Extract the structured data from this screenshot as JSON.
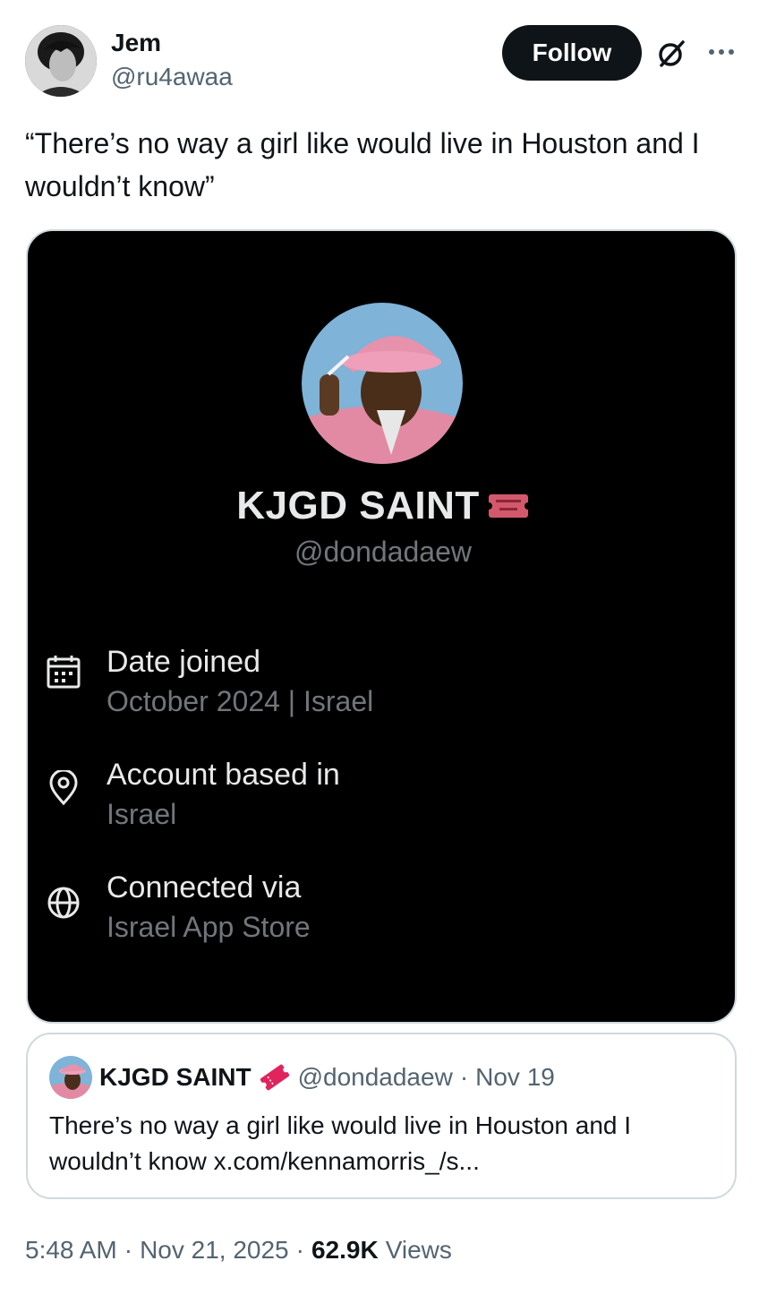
{
  "author": {
    "name": "Jem",
    "handle": "@ru4awaa",
    "follow_label": "Follow"
  },
  "tweet": {
    "text": "“There’s no way a girl like would live in Houston and I wouldn’t know”"
  },
  "media": {
    "profile_name": "KJGD SAINT",
    "profile_handle": "@dondadaew",
    "info": [
      {
        "icon": "calendar-icon",
        "title": "Date joined",
        "value": "October 2024 | Israel"
      },
      {
        "icon": "location-pin-icon",
        "title": "Account based in",
        "value": "Israel"
      },
      {
        "icon": "globe-icon",
        "title": "Connected via",
        "value": "Israel App Store"
      }
    ]
  },
  "quote": {
    "name": "KJGD SAINT",
    "handle": "@dondadaew",
    "separator": "·",
    "date": "Nov 19",
    "text": "There’s no way a girl like would live in Houston and I wouldn’t know x.com/kennamorris_/s..."
  },
  "meta": {
    "time": "5:48 AM",
    "separator": "·",
    "date": "Nov 21, 2025",
    "views_count": "62.9K",
    "views_label": "Views"
  },
  "colors": {
    "text_primary": "#0f1419",
    "text_secondary": "#536471",
    "card_bg": "#000000",
    "card_text": "#e7e9ea",
    "card_text_muted": "#71767b",
    "border": "#cfd9de",
    "badge_pink": "#e0245e"
  }
}
